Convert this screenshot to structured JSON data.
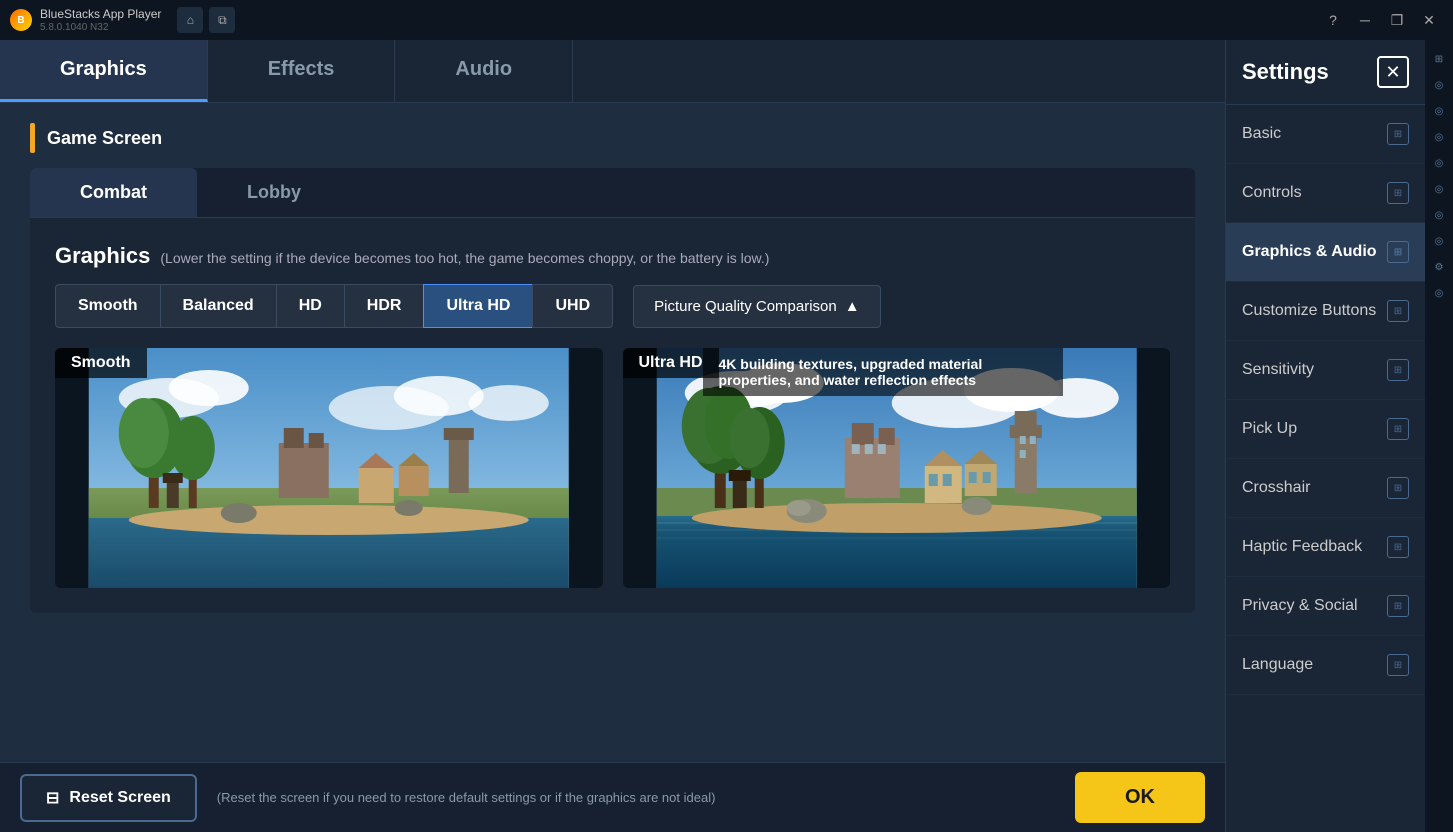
{
  "app": {
    "name": "BlueStacks App Player",
    "version": "5.8.0.1040  N32"
  },
  "titlebar": {
    "logo_text": "B",
    "home_icon": "⌂",
    "layers_icon": "⧉",
    "help_icon": "?",
    "minimize_icon": "─",
    "restore_icon": "❐",
    "close_icon": "✕"
  },
  "settings": {
    "title": "Settings",
    "close_icon": "✕",
    "tabs": [
      {
        "label": "Graphics",
        "active": true
      },
      {
        "label": "Effects",
        "active": false
      },
      {
        "label": "Audio",
        "active": false
      }
    ],
    "section_title": "Game Screen",
    "sub_tabs": [
      {
        "label": "Combat",
        "active": true
      },
      {
        "label": "Lobby",
        "active": false
      }
    ],
    "graphics": {
      "title": "Graphics",
      "hint": "(Lower the setting if the device becomes too hot, the game becomes choppy, or the battery is low.)",
      "quality_options": [
        {
          "label": "Smooth",
          "active": false
        },
        {
          "label": "Balanced",
          "active": false
        },
        {
          "label": "HD",
          "active": false
        },
        {
          "label": "HDR",
          "active": false
        },
        {
          "label": "Ultra HD",
          "active": true
        },
        {
          "label": "UHD",
          "active": false
        }
      ],
      "picture_quality_btn": "Picture Quality Comparison",
      "picture_quality_icon": "▲",
      "preview": [
        {
          "label": "Smooth",
          "description": ""
        },
        {
          "label": "Ultra HD",
          "description": "4K building textures, upgraded material properties, and water reflection effects"
        }
      ]
    },
    "bottom": {
      "reset_icon": "⊟",
      "reset_label": "Reset Screen",
      "reset_hint": "(Reset the screen if you need to restore default settings or if the graphics are not ideal)",
      "ok_label": "OK"
    }
  },
  "sidebar": {
    "title": "Settings",
    "close_icon": "✕",
    "items": [
      {
        "label": "Basic",
        "active": false
      },
      {
        "label": "Controls",
        "active": false
      },
      {
        "label": "Graphics & Audio",
        "active": true
      },
      {
        "label": "Customize Buttons",
        "active": false
      },
      {
        "label": "Sensitivity",
        "active": false
      },
      {
        "label": "Pick Up",
        "active": false
      },
      {
        "label": "Crosshair",
        "active": false
      },
      {
        "label": "Haptic Feedback",
        "active": false
      },
      {
        "label": "Privacy & Social",
        "active": false
      },
      {
        "label": "Language",
        "active": false
      }
    ]
  },
  "strip_icons": [
    "⊞",
    "◎",
    "◎",
    "◎",
    "◎",
    "◎",
    "◎",
    "◎",
    "⚙",
    "◎"
  ]
}
